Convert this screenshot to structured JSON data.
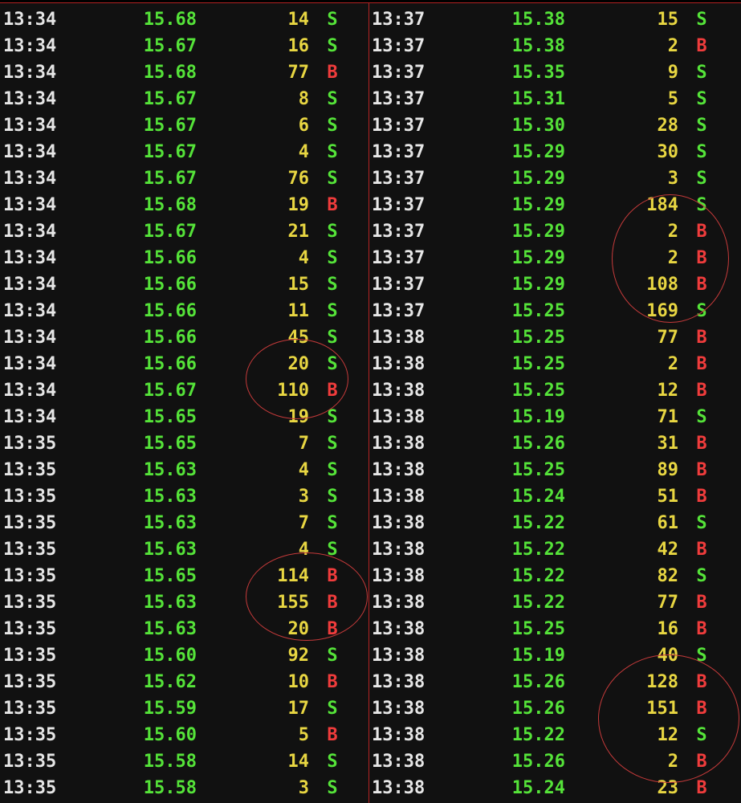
{
  "left_trades": [
    {
      "time": "13:34",
      "price": "15.68",
      "volume": "14",
      "side": "S"
    },
    {
      "time": "13:34",
      "price": "15.67",
      "volume": "16",
      "side": "S"
    },
    {
      "time": "13:34",
      "price": "15.68",
      "volume": "77",
      "side": "B"
    },
    {
      "time": "13:34",
      "price": "15.67",
      "volume": "8",
      "side": "S"
    },
    {
      "time": "13:34",
      "price": "15.67",
      "volume": "6",
      "side": "S"
    },
    {
      "time": "13:34",
      "price": "15.67",
      "volume": "4",
      "side": "S"
    },
    {
      "time": "13:34",
      "price": "15.67",
      "volume": "76",
      "side": "S"
    },
    {
      "time": "13:34",
      "price": "15.68",
      "volume": "19",
      "side": "B"
    },
    {
      "time": "13:34",
      "price": "15.67",
      "volume": "21",
      "side": "S"
    },
    {
      "time": "13:34",
      "price": "15.66",
      "volume": "4",
      "side": "S"
    },
    {
      "time": "13:34",
      "price": "15.66",
      "volume": "15",
      "side": "S"
    },
    {
      "time": "13:34",
      "price": "15.66",
      "volume": "11",
      "side": "S"
    },
    {
      "time": "13:34",
      "price": "15.66",
      "volume": "45",
      "side": "S"
    },
    {
      "time": "13:34",
      "price": "15.66",
      "volume": "20",
      "side": "S"
    },
    {
      "time": "13:34",
      "price": "15.67",
      "volume": "110",
      "side": "B"
    },
    {
      "time": "13:34",
      "price": "15.65",
      "volume": "19",
      "side": "S"
    },
    {
      "time": "13:35",
      "price": "15.65",
      "volume": "7",
      "side": "S"
    },
    {
      "time": "13:35",
      "price": "15.63",
      "volume": "4",
      "side": "S"
    },
    {
      "time": "13:35",
      "price": "15.63",
      "volume": "3",
      "side": "S"
    },
    {
      "time": "13:35",
      "price": "15.63",
      "volume": "7",
      "side": "S"
    },
    {
      "time": "13:35",
      "price": "15.63",
      "volume": "4",
      "side": "S"
    },
    {
      "time": "13:35",
      "price": "15.65",
      "volume": "114",
      "side": "B"
    },
    {
      "time": "13:35",
      "price": "15.63",
      "volume": "155",
      "side": "B"
    },
    {
      "time": "13:35",
      "price": "15.63",
      "volume": "20",
      "side": "B"
    },
    {
      "time": "13:35",
      "price": "15.60",
      "volume": "92",
      "side": "S"
    },
    {
      "time": "13:35",
      "price": "15.62",
      "volume": "10",
      "side": "B"
    },
    {
      "time": "13:35",
      "price": "15.59",
      "volume": "17",
      "side": "S"
    },
    {
      "time": "13:35",
      "price": "15.60",
      "volume": "5",
      "side": "B"
    },
    {
      "time": "13:35",
      "price": "15.58",
      "volume": "14",
      "side": "S"
    },
    {
      "time": "13:35",
      "price": "15.58",
      "volume": "3",
      "side": "S"
    }
  ],
  "right_trades": [
    {
      "time": "13:37",
      "price": "15.38",
      "volume": "15",
      "side": "S"
    },
    {
      "time": "13:37",
      "price": "15.38",
      "volume": "2",
      "side": "B"
    },
    {
      "time": "13:37",
      "price": "15.35",
      "volume": "9",
      "side": "S"
    },
    {
      "time": "13:37",
      "price": "15.31",
      "volume": "5",
      "side": "S"
    },
    {
      "time": "13:37",
      "price": "15.30",
      "volume": "28",
      "side": "S"
    },
    {
      "time": "13:37",
      "price": "15.29",
      "volume": "30",
      "side": "S"
    },
    {
      "time": "13:37",
      "price": "15.29",
      "volume": "3",
      "side": "S"
    },
    {
      "time": "13:37",
      "price": "15.29",
      "volume": "184",
      "side": "S"
    },
    {
      "time": "13:37",
      "price": "15.29",
      "volume": "2",
      "side": "B"
    },
    {
      "time": "13:37",
      "price": "15.29",
      "volume": "2",
      "side": "B"
    },
    {
      "time": "13:37",
      "price": "15.29",
      "volume": "108",
      "side": "B"
    },
    {
      "time": "13:37",
      "price": "15.25",
      "volume": "169",
      "side": "S"
    },
    {
      "time": "13:38",
      "price": "15.25",
      "volume": "77",
      "side": "B"
    },
    {
      "time": "13:38",
      "price": "15.25",
      "volume": "2",
      "side": "B"
    },
    {
      "time": "13:38",
      "price": "15.25",
      "volume": "12",
      "side": "B"
    },
    {
      "time": "13:38",
      "price": "15.19",
      "volume": "71",
      "side": "S"
    },
    {
      "time": "13:38",
      "price": "15.26",
      "volume": "31",
      "side": "B"
    },
    {
      "time": "13:38",
      "price": "15.25",
      "volume": "89",
      "side": "B"
    },
    {
      "time": "13:38",
      "price": "15.24",
      "volume": "51",
      "side": "B"
    },
    {
      "time": "13:38",
      "price": "15.22",
      "volume": "61",
      "side": "S"
    },
    {
      "time": "13:38",
      "price": "15.22",
      "volume": "42",
      "side": "B"
    },
    {
      "time": "13:38",
      "price": "15.22",
      "volume": "82",
      "side": "S"
    },
    {
      "time": "13:38",
      "price": "15.22",
      "volume": "77",
      "side": "B"
    },
    {
      "time": "13:38",
      "price": "15.25",
      "volume": "16",
      "side": "B"
    },
    {
      "time": "13:38",
      "price": "15.19",
      "volume": "40",
      "side": "S"
    },
    {
      "time": "13:38",
      "price": "15.26",
      "volume": "128",
      "side": "B"
    },
    {
      "time": "13:38",
      "price": "15.26",
      "volume": "151",
      "side": "B"
    },
    {
      "time": "13:38",
      "price": "15.22",
      "volume": "12",
      "side": "S"
    },
    {
      "time": "13:38",
      "price": "15.26",
      "volume": "2",
      "side": "B"
    },
    {
      "time": "13:38",
      "price": "15.24",
      "volume": "23",
      "side": "B"
    }
  ],
  "colors": {
    "background": "#111111",
    "time": "#e6e6e6",
    "price": "#55e339",
    "volume": "#e8d642",
    "sell": "#55e339",
    "buy": "#f03c3c",
    "annotation": "#c43a3a"
  }
}
